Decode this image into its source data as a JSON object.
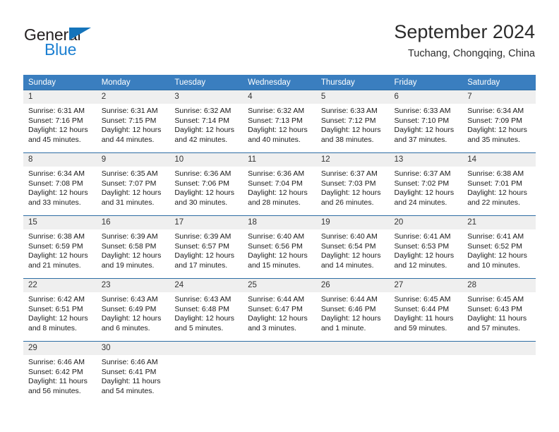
{
  "brand": {
    "name_part1": "General",
    "name_part2": "Blue",
    "triangle_color": "#1574bb",
    "blue_color": "#1b7fd1"
  },
  "header": {
    "title": "September 2024",
    "subtitle": "Tuchang, Chongqing, China"
  },
  "theme": {
    "header_bg": "#3a7ebf",
    "row_border": "#2e6da4",
    "daynum_bg": "#efefef"
  },
  "weekdays": [
    "Sunday",
    "Monday",
    "Tuesday",
    "Wednesday",
    "Thursday",
    "Friday",
    "Saturday"
  ],
  "weeks": [
    [
      {
        "day": "1",
        "sunrise": "Sunrise: 6:31 AM",
        "sunset": "Sunset: 7:16 PM",
        "daylight1": "Daylight: 12 hours",
        "daylight2": "and 45 minutes."
      },
      {
        "day": "2",
        "sunrise": "Sunrise: 6:31 AM",
        "sunset": "Sunset: 7:15 PM",
        "daylight1": "Daylight: 12 hours",
        "daylight2": "and 44 minutes."
      },
      {
        "day": "3",
        "sunrise": "Sunrise: 6:32 AM",
        "sunset": "Sunset: 7:14 PM",
        "daylight1": "Daylight: 12 hours",
        "daylight2": "and 42 minutes."
      },
      {
        "day": "4",
        "sunrise": "Sunrise: 6:32 AM",
        "sunset": "Sunset: 7:13 PM",
        "daylight1": "Daylight: 12 hours",
        "daylight2": "and 40 minutes."
      },
      {
        "day": "5",
        "sunrise": "Sunrise: 6:33 AM",
        "sunset": "Sunset: 7:12 PM",
        "daylight1": "Daylight: 12 hours",
        "daylight2": "and 38 minutes."
      },
      {
        "day": "6",
        "sunrise": "Sunrise: 6:33 AM",
        "sunset": "Sunset: 7:10 PM",
        "daylight1": "Daylight: 12 hours",
        "daylight2": "and 37 minutes."
      },
      {
        "day": "7",
        "sunrise": "Sunrise: 6:34 AM",
        "sunset": "Sunset: 7:09 PM",
        "daylight1": "Daylight: 12 hours",
        "daylight2": "and 35 minutes."
      }
    ],
    [
      {
        "day": "8",
        "sunrise": "Sunrise: 6:34 AM",
        "sunset": "Sunset: 7:08 PM",
        "daylight1": "Daylight: 12 hours",
        "daylight2": "and 33 minutes."
      },
      {
        "day": "9",
        "sunrise": "Sunrise: 6:35 AM",
        "sunset": "Sunset: 7:07 PM",
        "daylight1": "Daylight: 12 hours",
        "daylight2": "and 31 minutes."
      },
      {
        "day": "10",
        "sunrise": "Sunrise: 6:36 AM",
        "sunset": "Sunset: 7:06 PM",
        "daylight1": "Daylight: 12 hours",
        "daylight2": "and 30 minutes."
      },
      {
        "day": "11",
        "sunrise": "Sunrise: 6:36 AM",
        "sunset": "Sunset: 7:04 PM",
        "daylight1": "Daylight: 12 hours",
        "daylight2": "and 28 minutes."
      },
      {
        "day": "12",
        "sunrise": "Sunrise: 6:37 AM",
        "sunset": "Sunset: 7:03 PM",
        "daylight1": "Daylight: 12 hours",
        "daylight2": "and 26 minutes."
      },
      {
        "day": "13",
        "sunrise": "Sunrise: 6:37 AM",
        "sunset": "Sunset: 7:02 PM",
        "daylight1": "Daylight: 12 hours",
        "daylight2": "and 24 minutes."
      },
      {
        "day": "14",
        "sunrise": "Sunrise: 6:38 AM",
        "sunset": "Sunset: 7:01 PM",
        "daylight1": "Daylight: 12 hours",
        "daylight2": "and 22 minutes."
      }
    ],
    [
      {
        "day": "15",
        "sunrise": "Sunrise: 6:38 AM",
        "sunset": "Sunset: 6:59 PM",
        "daylight1": "Daylight: 12 hours",
        "daylight2": "and 21 minutes."
      },
      {
        "day": "16",
        "sunrise": "Sunrise: 6:39 AM",
        "sunset": "Sunset: 6:58 PM",
        "daylight1": "Daylight: 12 hours",
        "daylight2": "and 19 minutes."
      },
      {
        "day": "17",
        "sunrise": "Sunrise: 6:39 AM",
        "sunset": "Sunset: 6:57 PM",
        "daylight1": "Daylight: 12 hours",
        "daylight2": "and 17 minutes."
      },
      {
        "day": "18",
        "sunrise": "Sunrise: 6:40 AM",
        "sunset": "Sunset: 6:56 PM",
        "daylight1": "Daylight: 12 hours",
        "daylight2": "and 15 minutes."
      },
      {
        "day": "19",
        "sunrise": "Sunrise: 6:40 AM",
        "sunset": "Sunset: 6:54 PM",
        "daylight1": "Daylight: 12 hours",
        "daylight2": "and 14 minutes."
      },
      {
        "day": "20",
        "sunrise": "Sunrise: 6:41 AM",
        "sunset": "Sunset: 6:53 PM",
        "daylight1": "Daylight: 12 hours",
        "daylight2": "and 12 minutes."
      },
      {
        "day": "21",
        "sunrise": "Sunrise: 6:41 AM",
        "sunset": "Sunset: 6:52 PM",
        "daylight1": "Daylight: 12 hours",
        "daylight2": "and 10 minutes."
      }
    ],
    [
      {
        "day": "22",
        "sunrise": "Sunrise: 6:42 AM",
        "sunset": "Sunset: 6:51 PM",
        "daylight1": "Daylight: 12 hours",
        "daylight2": "and 8 minutes."
      },
      {
        "day": "23",
        "sunrise": "Sunrise: 6:43 AM",
        "sunset": "Sunset: 6:49 PM",
        "daylight1": "Daylight: 12 hours",
        "daylight2": "and 6 minutes."
      },
      {
        "day": "24",
        "sunrise": "Sunrise: 6:43 AM",
        "sunset": "Sunset: 6:48 PM",
        "daylight1": "Daylight: 12 hours",
        "daylight2": "and 5 minutes."
      },
      {
        "day": "25",
        "sunrise": "Sunrise: 6:44 AM",
        "sunset": "Sunset: 6:47 PM",
        "daylight1": "Daylight: 12 hours",
        "daylight2": "and 3 minutes."
      },
      {
        "day": "26",
        "sunrise": "Sunrise: 6:44 AM",
        "sunset": "Sunset: 6:46 PM",
        "daylight1": "Daylight: 12 hours",
        "daylight2": "and 1 minute."
      },
      {
        "day": "27",
        "sunrise": "Sunrise: 6:45 AM",
        "sunset": "Sunset: 6:44 PM",
        "daylight1": "Daylight: 11 hours",
        "daylight2": "and 59 minutes."
      },
      {
        "day": "28",
        "sunrise": "Sunrise: 6:45 AM",
        "sunset": "Sunset: 6:43 PM",
        "daylight1": "Daylight: 11 hours",
        "daylight2": "and 57 minutes."
      }
    ],
    [
      {
        "day": "29",
        "sunrise": "Sunrise: 6:46 AM",
        "sunset": "Sunset: 6:42 PM",
        "daylight1": "Daylight: 11 hours",
        "daylight2": "and 56 minutes."
      },
      {
        "day": "30",
        "sunrise": "Sunrise: 6:46 AM",
        "sunset": "Sunset: 6:41 PM",
        "daylight1": "Daylight: 11 hours",
        "daylight2": "and 54 minutes."
      },
      {
        "day": "",
        "sunrise": "",
        "sunset": "",
        "daylight1": "",
        "daylight2": ""
      },
      {
        "day": "",
        "sunrise": "",
        "sunset": "",
        "daylight1": "",
        "daylight2": ""
      },
      {
        "day": "",
        "sunrise": "",
        "sunset": "",
        "daylight1": "",
        "daylight2": ""
      },
      {
        "day": "",
        "sunrise": "",
        "sunset": "",
        "daylight1": "",
        "daylight2": ""
      },
      {
        "day": "",
        "sunrise": "",
        "sunset": "",
        "daylight1": "",
        "daylight2": ""
      }
    ]
  ]
}
